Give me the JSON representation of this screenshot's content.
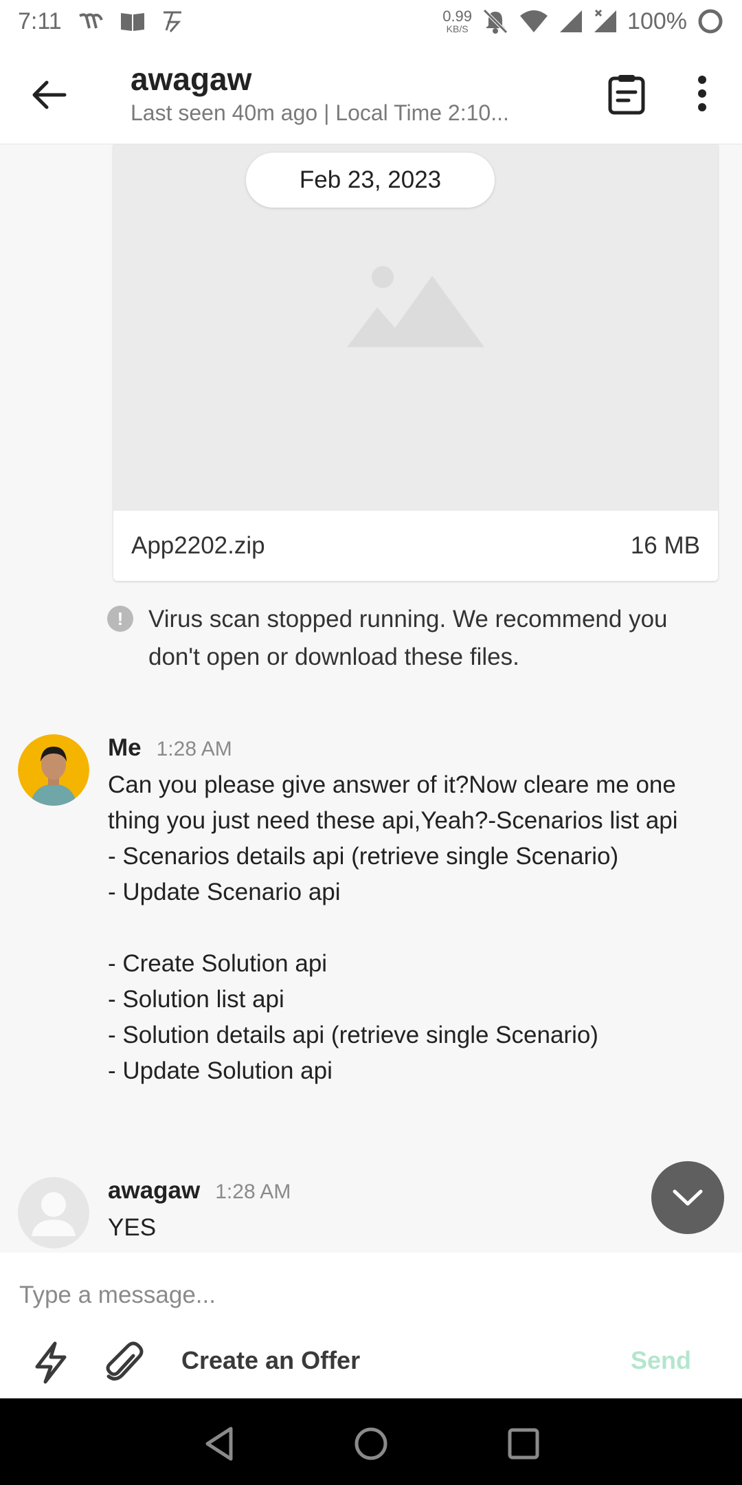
{
  "status_bar": {
    "time": "7:11",
    "net_speed_value": "0.99",
    "net_speed_unit": "KB/S",
    "battery": "100%",
    "left_icons": [
      "wifi-calling-icon",
      "book-icon",
      "tesla-icon"
    ],
    "right_icons": [
      "mute-icon",
      "wifi-icon",
      "signal-icon",
      "signal-x-icon",
      "battery-ring-icon"
    ]
  },
  "header": {
    "title": "awagaw",
    "subtitle": "Last seen 40m ago | Local Time 2:10..."
  },
  "chat": {
    "date_pill": "Feb 23, 2023",
    "attachment": {
      "file_name": "App2202.zip",
      "file_size": "16 MB"
    },
    "warning": "Virus scan stopped running. We recommend you don't open or download these files.",
    "messages": [
      {
        "sender": "Me",
        "time": "1:28 AM",
        "text": "Can you please give answer of it?Now cleare me one thing you just need these api,Yeah?-Scenarios list api\n- Scenarios details api (retrieve single Scenario)\n- Update Scenario api\n\n- Create Solution api\n- Solution list api\n- Solution details api (retrieve single Scenario)\n- Update Solution api"
      },
      {
        "sender": "awagaw",
        "time": "1:28 AM",
        "text": "YES"
      }
    ]
  },
  "composer": {
    "placeholder": "Type a message...",
    "create_offer_label": "Create an Offer",
    "send_label": "Send"
  },
  "colors": {
    "send_disabled": "#b4e6cd",
    "avatar_bg_me": "#f4b400",
    "scroll_button": "#5f5f5f"
  }
}
